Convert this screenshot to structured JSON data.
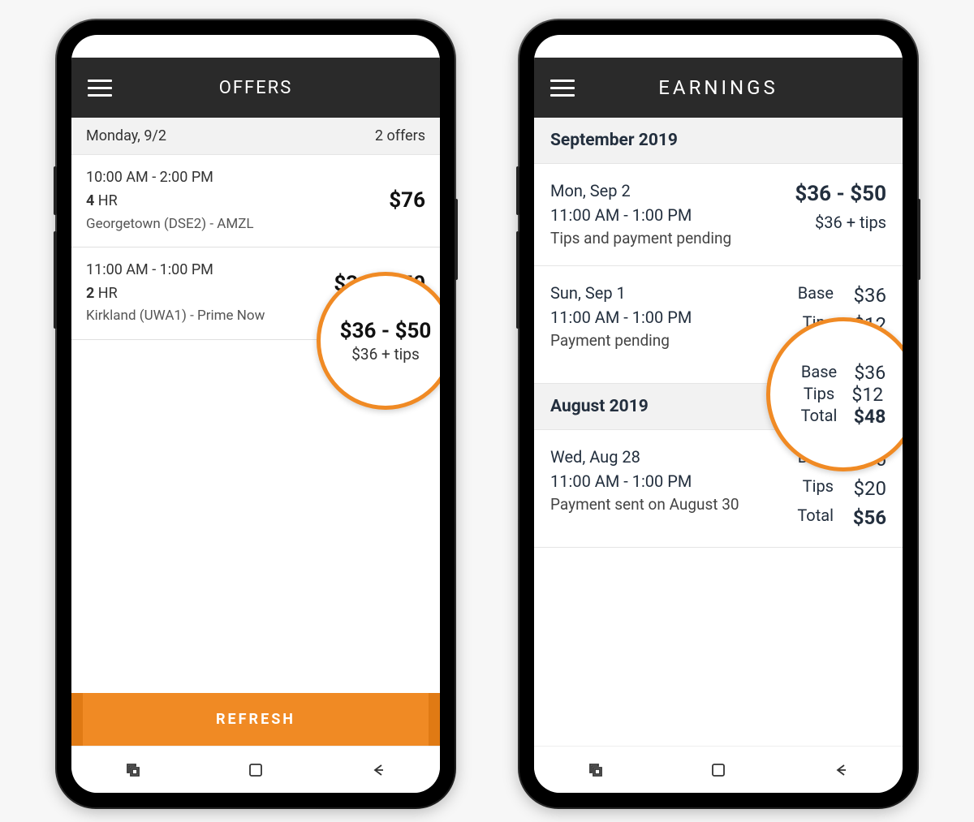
{
  "left": {
    "title": "OFFERS",
    "dateHeader": {
      "date": "Monday, 9/2",
      "count": "2 offers"
    },
    "offers": [
      {
        "time": "10:00 AM - 2:00 PM",
        "hours": "4",
        "hrLabel": "HR",
        "location": "Georgetown (DSE2)  - AMZL",
        "price": "$76"
      },
      {
        "time": "11:00 AM - 1:00 PM",
        "hours": "2",
        "hrLabel": "HR",
        "location": "Kirkland (UWA1)  -  Prime Now",
        "price": "$36 - $50",
        "sub": "$36 + tips"
      }
    ],
    "refresh": "REFRESH",
    "highlight": {
      "line1": "$36 - $50",
      "line2": "$36 + tips"
    }
  },
  "right": {
    "title": "EARNINGS",
    "sections": [
      {
        "header": "September 2019",
        "rows": [
          {
            "date": "Mon, Sep 2",
            "time": "11:00 AM - 1:00 PM",
            "status": "Tips and payment pending",
            "main": "$36 - $50",
            "sub": "$36 + tips"
          },
          {
            "date": "Sun, Sep 1",
            "time": "11:00 AM - 1:00 PM",
            "status": "Payment pending",
            "base": {
              "label": "Base",
              "value": "$36"
            },
            "tips": {
              "label": "Tips",
              "value": "$12"
            },
            "total": {
              "label": "Total",
              "value": "$48"
            }
          }
        ]
      },
      {
        "header": "August 2019",
        "rows": [
          {
            "date": "Wed, Aug 28",
            "time": "11:00 AM - 1:00 PM",
            "status": "Payment sent on August 30",
            "base": {
              "label": "Base",
              "value": "$36"
            },
            "tips": {
              "label": "Tips",
              "value": "$20"
            },
            "total": {
              "label": "Total",
              "value": "$56"
            }
          }
        ]
      }
    ],
    "highlight": {
      "base": {
        "label": "Base",
        "value": "$36"
      },
      "tips": {
        "label": "Tips",
        "value": "$12"
      },
      "total": {
        "label": "Total",
        "value": "$48"
      }
    }
  }
}
